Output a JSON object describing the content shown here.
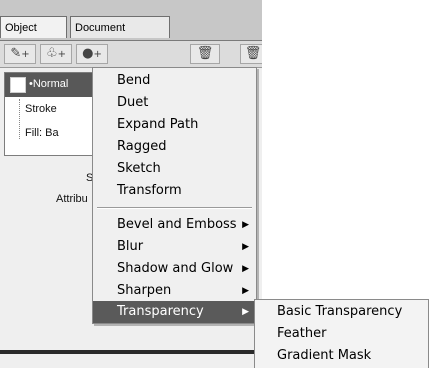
{
  "tabs": {
    "object": "Object",
    "document": "Document"
  },
  "layers": {
    "selected": "•Normal",
    "stroke": "Stroke",
    "fill": "Fill: Ba"
  },
  "properties": {
    "s_label": "S",
    "attrib_label": "Attribu"
  },
  "menu": {
    "items": [
      "Bend",
      "Duet",
      "Expand Path",
      "Ragged",
      "Sketch",
      "Transform"
    ],
    "group_items": [
      "Bevel and Emboss",
      "Blur",
      "Shadow and Glow",
      "Sharpen",
      "Transparency"
    ],
    "highlighted": "Transparency"
  },
  "submenu": {
    "items": [
      "Basic Transparency",
      "Feather",
      "Gradient Mask"
    ]
  },
  "colors": {
    "highlight": "#5a5a5a",
    "panel": "#efefef",
    "selected_row": "#585858"
  }
}
